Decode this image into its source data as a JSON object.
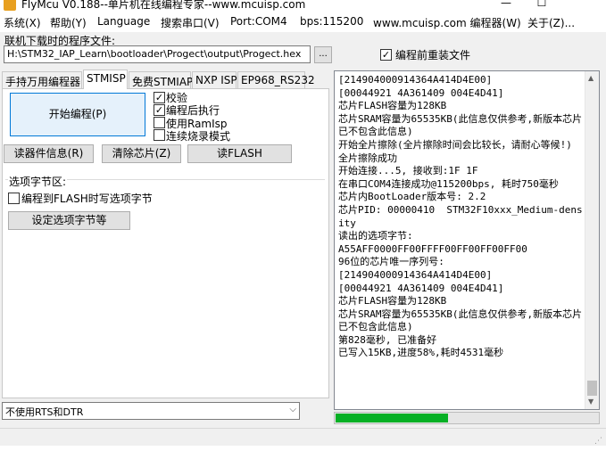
{
  "window": {
    "title": "FlyMcu V0.188--单片机在线编程专家--www.mcuisp.com",
    "minimize_glyph": "—",
    "maximize_glyph": "☐"
  },
  "menu": {
    "items": [
      "系统(X)",
      "帮助(Y)",
      "Language",
      "搜索串口(V)",
      "Port:COM4",
      "bps:115200",
      "www.mcuisp.com 编程器(W)",
      "关于(Z)..."
    ]
  },
  "file": {
    "label": "联机下载时的程序文件:",
    "path": "H:\\STM32_IAP_Learn\\bootloader\\Progect\\output\\Progect.hex",
    "browse_label": "...",
    "reload_label": "编程前重装文件",
    "reload_checked": true
  },
  "tabs": [
    {
      "label": "手持万用编程器",
      "active": false
    },
    {
      "label": "STMISP",
      "active": true
    },
    {
      "label": "免费STMIAP",
      "active": false
    },
    {
      "label": "NXP ISP",
      "active": false
    },
    {
      "label": "EP968_RS232",
      "active": false
    }
  ],
  "stmisp": {
    "start_button": "开始编程(P)",
    "options": [
      {
        "label": "校验",
        "checked": true
      },
      {
        "label": "编程后执行",
        "checked": true
      },
      {
        "label": "使用RamIsp",
        "checked": false
      },
      {
        "label": "连续烧录模式",
        "checked": false
      }
    ],
    "read_info_button": "读器件信息(R)",
    "erase_button": "清除芯片(Z)",
    "read_flash_button": "读FLASH",
    "option_bytes_title": "选项字节区:",
    "write_option_label": "编程到FLASH时写选项字节",
    "write_option_checked": false,
    "set_option_button": "设定选项字节等"
  },
  "rts_dtr": {
    "selected": "不使用RTS和DTR",
    "arrow_glyph": "⌵"
  },
  "log": {
    "lines": [
      "[214904000914364A414D4E00]",
      "[00044921 4A361409 004E4D41]",
      "芯片FLASH容量为128KB",
      "芯片SRAM容量为65535KB(此信息仅供参考,新版本芯片已不包含此信息)",
      "开始全片擦除(全片擦除时间会比较长，请耐心等候!)",
      "全片擦除成功",
      "开始连接...5, 接收到:1F 1F",
      "在串口COM4连接成功@115200bps, 耗时750毫秒",
      "芯片内BootLoader版本号: 2.2",
      "芯片PID: 00000410  STM32F10xxx_Medium-density",
      "读出的选项字节:",
      "A55AFF0000FF00FFFF00FF00FF00FF00",
      "96位的芯片唯一序列号:",
      "[214904000914364A414D4E00]",
      "[00044921 4A361409 004E4D41]",
      "芯片FLASH容量为128KB",
      "芯片SRAM容量为65535KB(此信息仅供参考,新版本芯片已不包含此信息)",
      "第828毫秒, 已准备好",
      "已写入15KB,进度58%,耗时4531毫秒"
    ],
    "scroll_up_glyph": "▲",
    "scroll_down_glyph": "▼"
  },
  "progress": {
    "fraction": 0.43,
    "fill_color": "#06b025"
  }
}
